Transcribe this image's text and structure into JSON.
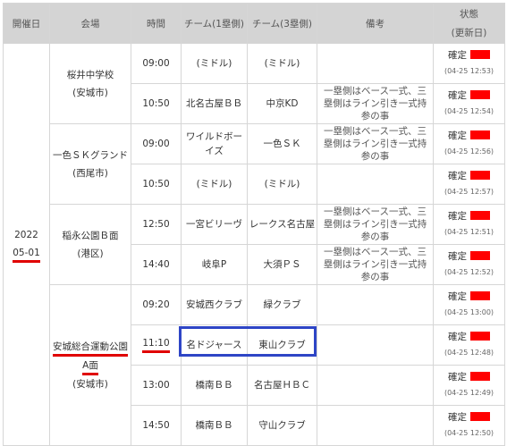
{
  "headers": {
    "date": "開催日",
    "venue": "会場",
    "time": "時間",
    "team1": "チーム(1塁側)",
    "team3": "チーム(3塁側)",
    "note": "備考",
    "status_line1": "状態",
    "status_line2": "(更新日)"
  },
  "date": {
    "year": "2022",
    "day": "05-01"
  },
  "venues": [
    {
      "name": "桜井中学校",
      "area": "(安城市)"
    },
    {
      "name": "一色ＳＫグランド",
      "area": "(西尾市)"
    },
    {
      "name": "稲永公園Ｂ面",
      "area": "(港区)"
    },
    {
      "name_part1": "安城総合運動公園",
      "name_part2": "A面",
      "area": "(安城市)"
    }
  ],
  "rows": [
    {
      "time": "09:00",
      "team1": "(ミドル)",
      "team3": "(ミドル)",
      "note": "",
      "status": "確定",
      "updated": "(04-25 12:53)"
    },
    {
      "time": "10:50",
      "team1": "北名古屋ＢＢ",
      "team3": "中京KD",
      "note": "一塁側はベース一式、三塁側はライン引き一式持参の事",
      "status": "確定",
      "updated": "(04-25 12:54)"
    },
    {
      "time": "09:00",
      "team1": "ワイルドボーイズ",
      "team3": "一色ＳＫ",
      "note": "一塁側はベース一式、三塁側はライン引き一式持参の事",
      "status": "確定",
      "updated": "(04-25 12:56)"
    },
    {
      "time": "10:50",
      "team1": "(ミドル)",
      "team3": "(ミドル)",
      "note": "",
      "status": "確定",
      "updated": "(04-25 12:57)"
    },
    {
      "time": "12:50",
      "team1": "一宮ビリーヴ",
      "team3": "レークス名古屋",
      "note": "一塁側はベース一式、三塁側はライン引き一式持参の事",
      "status": "確定",
      "updated": "(04-25 12:51)"
    },
    {
      "time": "14:40",
      "team1": "岐阜P",
      "team3": "大須ＰＳ",
      "note": "一塁側はベース一式、三塁側はライン引き一式持参の事",
      "status": "確定",
      "updated": "(04-25 12:52)"
    },
    {
      "time": "09:20",
      "team1": "安城西クラブ",
      "team3": "緑クラブ",
      "note": "",
      "status": "確定",
      "updated": "(04-25 13:00)"
    },
    {
      "time": "11:10",
      "team1": "名ドジャース",
      "team3": "東山クラブ",
      "note": "",
      "status": "確定",
      "updated": "(04-25 12:48)"
    },
    {
      "time": "13:00",
      "team1": "橋南ＢＢ",
      "team3": "名古屋ＨＢＣ",
      "note": "",
      "status": "確定",
      "updated": "(04-25 12:49)"
    },
    {
      "time": "14:50",
      "team1": "橋南ＢＢ",
      "team3": "守山クラブ",
      "note": "",
      "status": "確定",
      "updated": "(04-25 12:50)"
    }
  ],
  "colors": {
    "header_bg": "#d4d4d4",
    "underline": "#e00000",
    "status_badge": "#ff0000",
    "highlight_box": "#2e45c6"
  }
}
